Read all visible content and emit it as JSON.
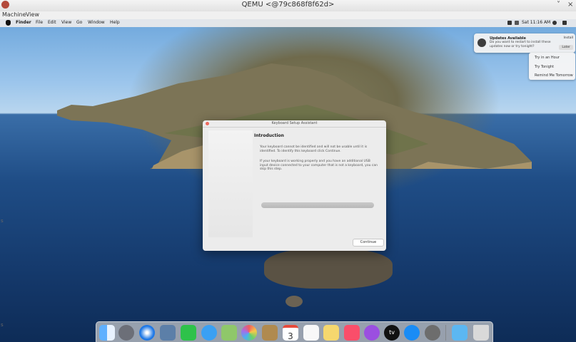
{
  "window": {
    "title": "QEMU <@79c868f8f62d>",
    "minimize_glyph": "˅",
    "close_glyph": "×",
    "menu": [
      "Machine",
      "View"
    ]
  },
  "mac_menubar": {
    "app": "Finder",
    "items": [
      "File",
      "Edit",
      "View",
      "Go",
      "Window",
      "Help"
    ],
    "clock": "Sat 11:16 AM"
  },
  "notification": {
    "title": "Updates Available",
    "body": "Do you want to restart to install these updates now or try tonight?",
    "install_label": "Install",
    "later_label": "Later",
    "menu_items": [
      "Try in an Hour",
      "Try Tonight",
      "Remind Me Tomorrow"
    ]
  },
  "dialog": {
    "title": "Keyboard Setup Assistant",
    "heading": "Introduction",
    "paragraph1": "Your keyboard cannot be identified and will not be usable until it is identified. To identify this keyboard click Continue.",
    "paragraph2": "If your keyboard is working properly and you have an additional USB input device connected to your computer that is not a keyboard, you can skip this step.",
    "continue_label": "Continue"
  },
  "dock": {
    "calendar_day": "3",
    "apple_tv_label": "tv",
    "icons": [
      "finder-icon",
      "launchpad-icon",
      "safari-icon",
      "preview-icon",
      "facetime-icon",
      "messages-icon",
      "maps-icon",
      "photos-icon",
      "contacts-icon",
      "calendar-icon",
      "reminders-icon",
      "notes-icon",
      "music-icon",
      "podcasts-icon",
      "apple-tv-icon",
      "app-store-icon",
      "system-preferences-icon",
      "downloads-folder-icon",
      "trash-icon"
    ]
  },
  "colors": {
    "close_button": "#ed6a5e",
    "sea": "#1f4d86",
    "sky": "#9dc6ec"
  },
  "edge_glyphs": [
    "s",
    "s"
  ]
}
